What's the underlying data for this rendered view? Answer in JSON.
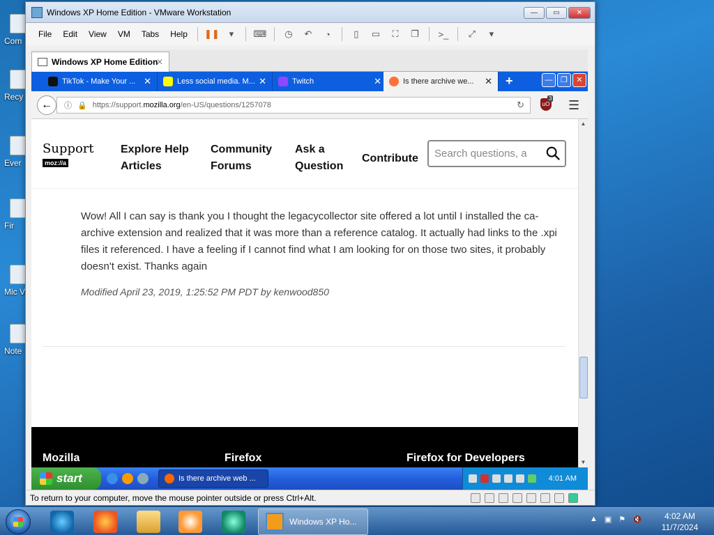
{
  "desktop": {
    "icons": [
      {
        "label": "Com"
      },
      {
        "label": "Recy"
      },
      {
        "label": "Ever"
      },
      {
        "label": "Fir"
      },
      {
        "label": "Mic Visua"
      },
      {
        "label": "Note"
      }
    ]
  },
  "vmware": {
    "title": "Windows XP Home Edition - VMware Workstation",
    "menu": [
      "File",
      "Edit",
      "View",
      "VM",
      "Tabs",
      "Help"
    ],
    "vm_tab": "Windows XP Home Edition",
    "status_text": "To return to your computer, move the mouse pointer outside or press Ctrl+Alt."
  },
  "firefox": {
    "tabs": [
      {
        "label": "TikTok - Make Your ...",
        "color": "#111111"
      },
      {
        "label": "Less social media. M...",
        "color": "#fffc00"
      },
      {
        "label": "Twitch",
        "color": "#9146ff"
      },
      {
        "label": "Is there archive we...",
        "color": "#ff7139",
        "active": true
      }
    ],
    "url_prefix": "https://support.",
    "url_domain": "mozilla.org",
    "url_path": "/en-US/questions/1257078",
    "ublock_count": "3"
  },
  "page": {
    "logo_top": "Support",
    "logo_bottom": "moz://a",
    "nav": [
      {
        "line1": "Explore Help",
        "line2": "Articles"
      },
      {
        "line1": "Community",
        "line2": "Forums"
      },
      {
        "line1": "Ask a",
        "line2": "Question"
      },
      {
        "line1": "Contribute",
        "line2": ""
      }
    ],
    "search_placeholder": "Search questions, a",
    "post_text": "Wow! All I can say is thank you I thought the legacycollector site offered a lot until I installed the ca-archive extension and realized that it was more than a reference catalog. It actually had links to the .xpi files it referenced. I have a feeling if I cannot find what I am looking for on those two sites, it probably doesn't exist. Thanks again",
    "modified": "Modified April 23, 2019, 1:25:52 PM PDT by kenwood850",
    "footer": [
      "Mozilla",
      "Firefox",
      "Firefox for Developers"
    ]
  },
  "xp_taskbar": {
    "start": "start",
    "window": "Is there archive web ...",
    "clock": "4:01 AM"
  },
  "win7_taskbar": {
    "active_window": "Windows XP Ho...",
    "time": "4:02 AM",
    "date": "11/7/2024"
  }
}
